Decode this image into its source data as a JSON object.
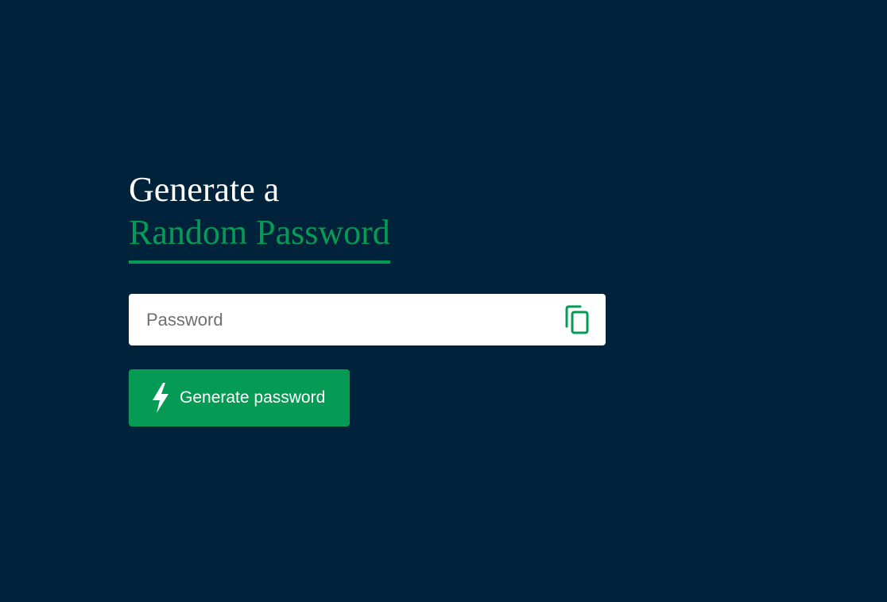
{
  "heading": {
    "line1": "Generate a",
    "line2": "Random Password"
  },
  "password_field": {
    "placeholder": "Password",
    "value": ""
  },
  "generate_button": {
    "label": "Generate password"
  },
  "icons": {
    "copy": "copy-icon",
    "generate": "lightning-bolt-icon"
  },
  "colors": {
    "background": "#00223a",
    "accent": "#059b54",
    "field_background": "#ffffff",
    "heading_text": "#ffffff"
  }
}
